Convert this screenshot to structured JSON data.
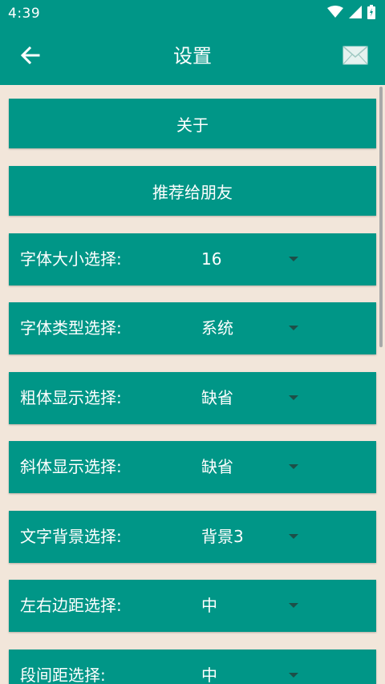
{
  "status": {
    "time": "4:39"
  },
  "appbar": {
    "title": "设置",
    "back_icon": "arrow-left-icon",
    "mail_icon": "mail-icon"
  },
  "buttons": [
    {
      "label": "关于"
    },
    {
      "label": "推荐给朋友"
    }
  ],
  "settings": [
    {
      "label": "字体大小选择:",
      "value": "16"
    },
    {
      "label": "字体类型选择:",
      "value": "系统"
    },
    {
      "label": "粗体显示选择:",
      "value": "缺省"
    },
    {
      "label": "斜体显示选择:",
      "value": "缺省"
    },
    {
      "label": "文字背景选择:",
      "value": "背景3"
    },
    {
      "label": "左右边距选择:",
      "value": "中"
    },
    {
      "label": "段间距选择:",
      "value": "中"
    }
  ],
  "colors": {
    "primary": "#009687",
    "background": "#f2e6da"
  }
}
